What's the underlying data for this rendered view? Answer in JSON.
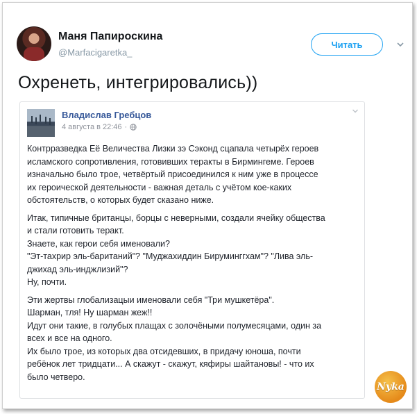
{
  "tweet": {
    "display_name": "Маня Папироскина",
    "handle": "@Marfacigaretka_",
    "follow_label": "Читать",
    "text": "Охренеть, интегрировались))"
  },
  "fb_post": {
    "author": "Владислав Гребцов",
    "timestamp": "4 августа в 22:46",
    "separator": "·",
    "paragraphs": [
      "Контрразведка Её Величества Лизки зэ Сэконд сцапала четырёх героев\nисламского сопротивления, готовивших теракты в Бирмингеме. Героев\nизначально было трое, четвёртый присоединился к ним уже в процессе\nих героической деятельности - важная деталь с учётом кое-каких\nобстоятельств, о которых будет сказано ниже.",
      "Итак, типичные британцы, борцы с неверными, создали ячейку общества\nи стали готовить теракт.\nЗнаете, как герои себя именовали?\n\"Эт-тахрир эль-баританий\"? \"Муджахиддин Бируминггхам\"? \"Лива эль-\nджихад эль-инджлизий\"?\nНу, почти.",
      "Эти жертвы глобализацыи именовали себя \"Три мушкетёра\".\nШарман, тля! Ну шарман жеж!!\nИдут они такие, в голубых плащах с золочёными полумесяцами, один за\nвсех и все на одного.\nИх было трое, из которых два отсидевших, в придачу юноша, почти\nребёнок лет тридцати... А скажут - скажут, кяфиры шайтановы! - что их\nбыло четверо."
    ]
  },
  "watermark": {
    "text": "Nyka"
  },
  "icons": {
    "follow_caret": "chevron-down-icon",
    "fb_options": "chevron-down-icon",
    "privacy": "globe-icon"
  },
  "colors": {
    "twitter_blue": "#1da1f2",
    "fb_link": "#365899",
    "muted": "#8899a6"
  }
}
